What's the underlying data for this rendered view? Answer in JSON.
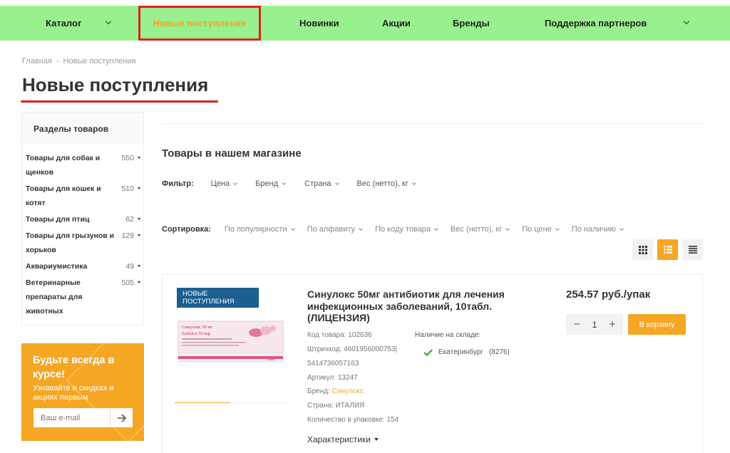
{
  "nav": {
    "catalog": "Каталог",
    "new_arrivals": "Новые поступления",
    "novelties": "Новинки",
    "promotions": "Акции",
    "brands": "Бренды",
    "partner_support": "Поддержка партнеров"
  },
  "breadcrumb": {
    "home": "Главная",
    "separator": "-",
    "current": "Новые поступления"
  },
  "page_title": "Новые поступления",
  "sidebar": {
    "title": "Разделы товаров",
    "items": [
      {
        "label": "Товары для собак и щенков",
        "count": "550"
      },
      {
        "label": "Товары для кошек и котят",
        "count": "510"
      },
      {
        "label": "Товары для птиц",
        "count": "62"
      },
      {
        "label": "Товары для грызунов и хорьков",
        "count": "129"
      },
      {
        "label": "Аквариумистика",
        "count": "49"
      },
      {
        "label": "Ветеринарные препараты для животных",
        "count": "505"
      }
    ]
  },
  "subscribe": {
    "title": "Будьте всегда в курсе!",
    "text": "Узнавайте о скидках и акциях первым",
    "placeholder": "Ваш e-mail"
  },
  "section_title": "Товары в нашем магазине",
  "filter": {
    "label": "Фильтр:",
    "options": [
      "Цена",
      "Бренд",
      "Страна",
      "Вес (нетто), кг"
    ]
  },
  "sort": {
    "label": "Сортировка:",
    "options": [
      "По популярности",
      "По алфавиту",
      "По коду товара",
      "Вес (нетто), кг",
      "По цене",
      "По наличию"
    ]
  },
  "product": {
    "badge": "НОВЫЕ ПОСТУПЛЕНИЯ",
    "title": "Синулокс 50мг антибиотик для лечения инфекционных заболеваний, 10табл. (ЛИЦЕНЗИЯ)",
    "code": "Код товара: 102636",
    "barcode_1": "Штрихкод: 4601956000753|",
    "barcode_2": "5414736057163",
    "article": "Артикул: 13247",
    "brand_label": "Бренд: ",
    "brand": "Синулокс",
    "country": "Страна: ИТАЛИЯ",
    "pack_qty": "Количество в упаковке: 154",
    "availability_label": "Наличие на складе:",
    "warehouse": "Екатеринбург",
    "warehouse_count": "(8276)",
    "characteristics": "Характеристики",
    "price": "254.57 руб./упак",
    "qty": "1",
    "minus": "−",
    "plus": "+",
    "cart": "В корзину",
    "package_text_1": "Синулокс 50 мг",
    "package_text_2": "Synulox 50 mg",
    "package_brand": "zoetis"
  },
  "colors": {
    "nav_bg": "#99f08e",
    "accent": "#f5a623",
    "highlight": "#e02020",
    "badge": "#1c5e8e"
  },
  "icons": {
    "view_grid": "grid-icon",
    "view_list": "list-icon",
    "view_table": "table-icon",
    "subscribe_submit": "arrow-right-icon",
    "in_stock": "check-icon"
  }
}
